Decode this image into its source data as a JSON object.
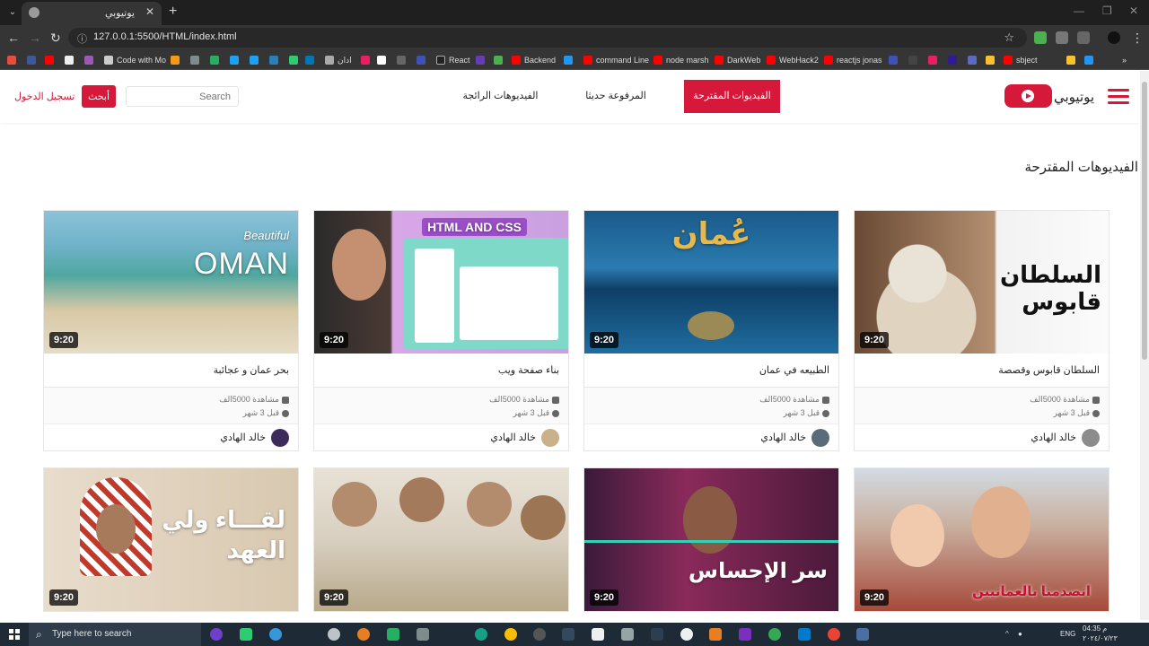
{
  "browser": {
    "tab_title": "يوتيوبي",
    "url": "127.0.0.1:5500/HTML/index.html",
    "bookmarks": [
      "Code with Mo",
      "ادان",
      "React",
      "Backend",
      "command Line",
      "node marsh",
      "DarkWeb",
      "WebHack2",
      "reactjs jonas",
      "sbject"
    ]
  },
  "header": {
    "brand": "يوتيوبي",
    "nav": [
      "الفيديوات المقترحة",
      "المرفوعة حديثا",
      "الفيديوهات الرائجة"
    ],
    "search_placeholder": "Search",
    "search_button": "أبحث",
    "login": "تسجيل الدخول"
  },
  "section_title": "الفيديوهات المقترحة",
  "videos": [
    {
      "title": "السلطان قابوس وقصصة",
      "duration": "9:20",
      "views": "مشاهدة 5000الف",
      "age": "قبل 3 شهر",
      "author": "خالد الهادي",
      "thumb_text": "السلطان قابوس",
      "thumb_colors": [
        "#5a3b2a",
        "#b38b6d"
      ],
      "avatar_color": "#8c8c8c"
    },
    {
      "title": "الطبيعه في عمان",
      "duration": "9:20",
      "views": "مشاهدة 5000الف",
      "age": "قبل 3 شهر",
      "author": "خالد الهادي",
      "thumb_text": "عُمان",
      "thumb_colors": [
        "#2a6fa0",
        "#0f3b63"
      ],
      "avatar_color": "#5a6b7a"
    },
    {
      "title": "بناء صفحة ويب",
      "duration": "9:20",
      "views": "مشاهدة 5000الف",
      "age": "قبل 3 شهر",
      "author": "خالد الهادي",
      "thumb_text": "HTML AND CSS",
      "thumb_colors": [
        "#d9a7e8",
        "#7fd9c8"
      ],
      "avatar_color": "#c9b28a"
    },
    {
      "title": "بحر عمان و عجائبة",
      "duration": "9:20",
      "views": "مشاهدة 5000الف",
      "age": "قبل 3 شهر",
      "author": "خالد الهادي",
      "thumb_text": "OMAN",
      "thumb_colors": [
        "#6fb2c8",
        "#d8c9a6"
      ],
      "avatar_color": "#3c2a5a"
    },
    {
      "title": "",
      "duration": "9:20",
      "thumb_text": "انصدمنا بالعمانيين",
      "thumb_colors": [
        "#d3dbe3",
        "#a64a3a"
      ]
    },
    {
      "title": "",
      "duration": "9:20",
      "thumb_text": "سر الإحساس",
      "thumb_colors": [
        "#8a2a5a",
        "#3a1a3a"
      ]
    },
    {
      "title": "",
      "duration": "9:20",
      "thumb_text": "",
      "thumb_colors": [
        "#e8e2d6",
        "#b8a98a"
      ]
    },
    {
      "title": "",
      "duration": "9:20",
      "thumb_text": "لقـــاء ولي العهد",
      "thumb_colors": [
        "#e8dccb",
        "#cdb89a"
      ]
    }
  ],
  "taskbar": {
    "search": "Type here to search",
    "lang": "ENG",
    "time": "04:35 م",
    "date": "٢٠٢٤/٠٧/٢٣"
  }
}
